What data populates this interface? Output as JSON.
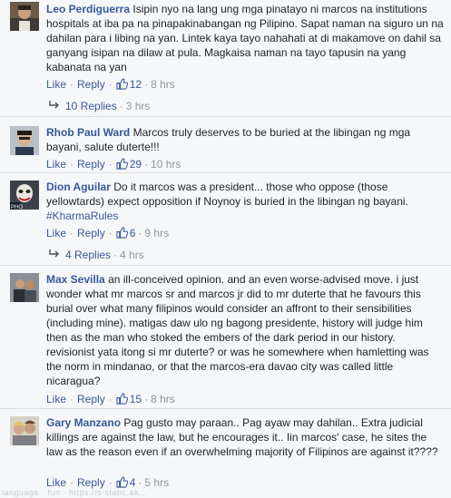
{
  "ui": {
    "like_label": "Like",
    "reply_label": "Reply",
    "separator": "·"
  },
  "comments": [
    {
      "author": "Leo Perdiguerra",
      "text": "Isipin nyo na lang ung mga pinatayo ni marcos na institutions hospitals at iba pa na pinapakinabangan ng Pilipino. Sapat naman na siguro un na dahilan para i libing na yan. Lintek kaya tayo nahahati at di makamove on dahil sa ganyang isipan na dilaw at pula. Magkaisa naman na tayo tapusin na yang kabanata na yan",
      "likes": "12",
      "time": "8 hrs",
      "replies_label": "10 Replies",
      "replies_time": "3 hrs"
    },
    {
      "author": "Rhob Paul Ward",
      "text": "Marcos truly deserves to be buried at the libingan ng mga bayani, salute duterte!!!",
      "likes": "29",
      "time": "10 hrs"
    },
    {
      "author": "Dion Aguilar",
      "text": "Do it marcos was a president... those who oppose (those yellowtards) expect opposition if Noynoy is buried in the libingan ng bayani.",
      "hashtag": "#KharmaRules",
      "likes": "6",
      "time": "9 hrs",
      "replies_label": "4 Replies",
      "replies_time": "4 hrs"
    },
    {
      "author": "Max Sevilla",
      "text": "an ill-conceived opinion. and an even worse-advised move. i just wonder what mr marcos sr and marcos jr did to mr duterte that he favours this burial over what many filipinos would consider an affront to their sensibilities (including mine). matigas daw ulo ng bagong presidente, history will judge him then as the man who stoked the embers of the dark period in our history. revisionist yata itong si mr duterte? or was he somewhere when hamletting was the norm in mindanao, or that the marcos-era davao city was called little nicaragua?",
      "likes": "15",
      "time": "8 hrs"
    },
    {
      "author": "Gary Manzano",
      "text": "Pag gusto may paraan.. Pag ayaw may dahilan.. Extra judicial killings are against the law, but he encourages it.. Iin marcos' case, he sites the law as the reason even if an overwhelming majority of Filipinos are against it????",
      "likes": "4",
      "time": "5 hrs"
    }
  ],
  "watermark": "language · fun · https://s-static.ak..."
}
